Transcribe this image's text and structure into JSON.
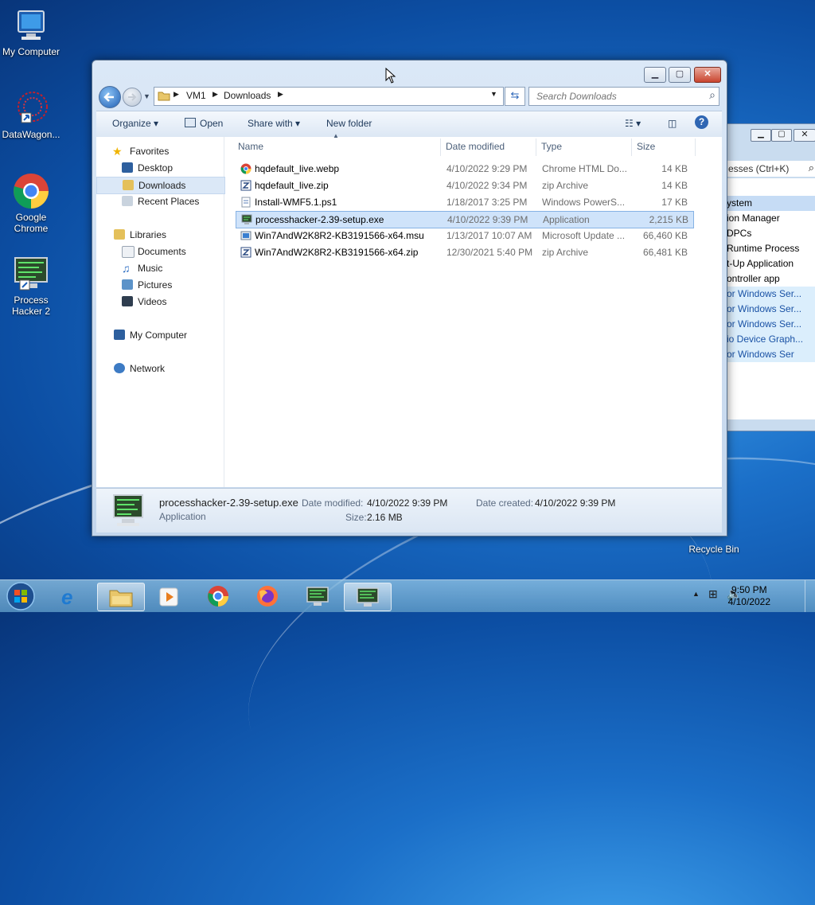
{
  "desktop": {
    "icons": [
      {
        "label": "My Computer"
      },
      {
        "label": "DataWagon..."
      },
      {
        "label": "Google Chrome"
      },
      {
        "label": "Process Hacker 2"
      },
      {
        "label": "Recycle Bin"
      }
    ]
  },
  "background_window": {
    "search_placeholder": "esses (Ctrl+K)",
    "rows": [
      "ystem",
      "ion Manager",
      "DPCs",
      "Runtime Process",
      "t-Up Application",
      "ontroller app",
      "or Windows Ser...",
      "or Windows Ser...",
      "or Windows Ser...",
      "io Device Graph...",
      "or Windows Ser"
    ]
  },
  "explorer": {
    "breadcrumb": [
      "VM1",
      "Downloads"
    ],
    "search_placeholder": "Search Downloads",
    "toolbar": {
      "organize": "Organize",
      "open": "Open",
      "share_with": "Share with",
      "new_folder": "New folder"
    },
    "nav": {
      "favorites": "Favorites",
      "desktop": "Desktop",
      "downloads": "Downloads",
      "recent_places": "Recent Places",
      "libraries": "Libraries",
      "documents": "Documents",
      "music": "Music",
      "pictures": "Pictures",
      "videos": "Videos",
      "my_computer": "My Computer",
      "network": "Network"
    },
    "columns": [
      "Name",
      "Date modified",
      "Type",
      "Size"
    ],
    "files": [
      {
        "name": "hqdefault_live.webp",
        "date": "4/10/2022 9:29 PM",
        "type": "Chrome HTML Do...",
        "size": "14 KB",
        "icon": "chrome-icon"
      },
      {
        "name": "hqdefault_live.zip",
        "date": "4/10/2022 9:34 PM",
        "type": "zip Archive",
        "size": "14 KB",
        "icon": "zip-icon"
      },
      {
        "name": "Install-WMF5.1.ps1",
        "date": "1/18/2017 3:25 PM",
        "type": "Windows PowerS...",
        "size": "17 KB",
        "icon": "script-icon"
      },
      {
        "name": "processhacker-2.39-setup.exe",
        "date": "4/10/2022 9:39 PM",
        "type": "Application",
        "size": "2,215 KB",
        "icon": "app-icon"
      },
      {
        "name": "Win7AndW2K8R2-KB3191566-x64.msu",
        "date": "1/13/2017 10:07 AM",
        "type": "Microsoft Update ...",
        "size": "66,460 KB",
        "icon": "msu-icon"
      },
      {
        "name": "Win7AndW2K8R2-KB3191566-x64.zip",
        "date": "12/30/2021 5:40 PM",
        "type": "zip Archive",
        "size": "66,481 KB",
        "icon": "zip-icon"
      }
    ],
    "details": {
      "name": "processhacker-2.39-setup.exe",
      "type": "Application",
      "date_modified_label": "Date modified:",
      "date_modified": "4/10/2022 9:39 PM",
      "date_created_label": "Date created:",
      "date_created": "4/10/2022 9:39 PM",
      "size_label": "Size:",
      "size": "2.16 MB"
    }
  },
  "taskbar": {
    "time": "9:50 PM",
    "date": "4/10/2022"
  }
}
